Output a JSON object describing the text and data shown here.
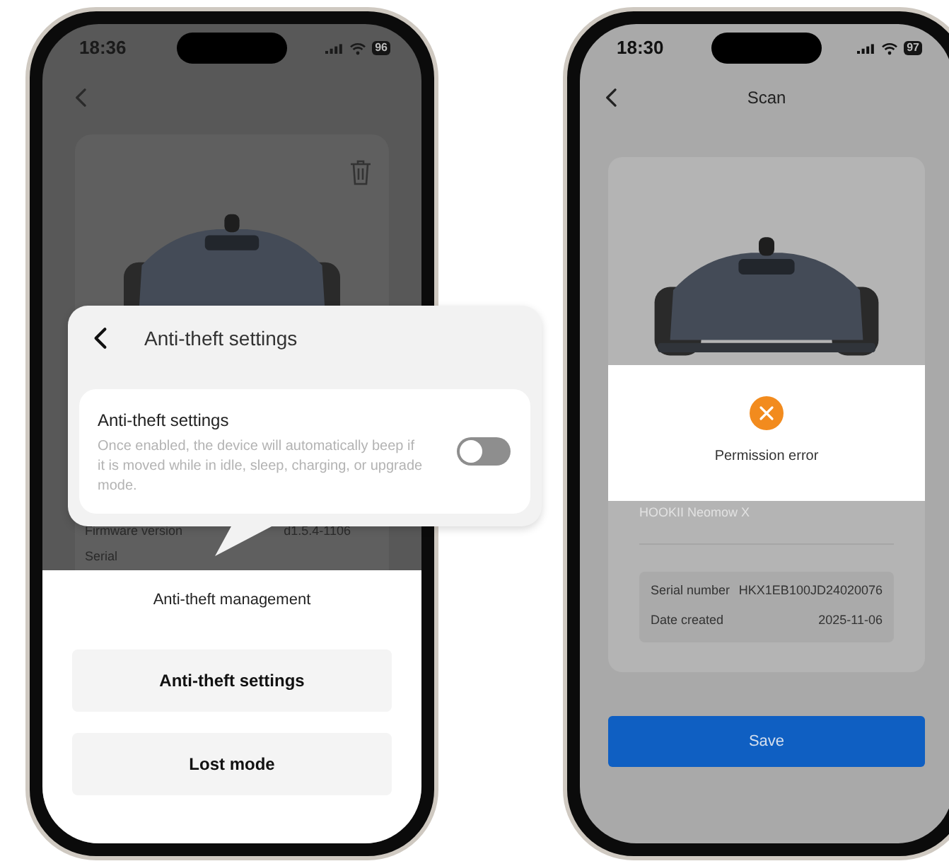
{
  "left_phone": {
    "status_bar": {
      "time": "18:36",
      "battery": "96"
    },
    "device_card": {
      "rows": [
        {
          "label": "Firmware version",
          "value": "d1.5.4-1106"
        },
        {
          "label": "Serial"
        }
      ]
    },
    "bottom_sheet": {
      "title": "Anti-theft management",
      "buttons": [
        "Anti-theft settings",
        "Lost mode"
      ]
    }
  },
  "callout": {
    "title": "Anti-theft settings",
    "setting": {
      "title": "Anti-theft settings",
      "description": "Once enabled, the device will automatically beep if it is moved while in idle, sleep, charging, or upgrade mode.",
      "on": false
    }
  },
  "right_phone": {
    "status_bar": {
      "time": "18:30",
      "battery": "97"
    },
    "title": "Scan",
    "dialog": {
      "message": "Permission error"
    },
    "device_name": "HOOKII Neomow X",
    "info": [
      {
        "label": "Serial number",
        "value": "HKX1EB100JD24020076"
      },
      {
        "label": "Date created",
        "value": "2025-11-06"
      }
    ],
    "save_button": "Save"
  }
}
